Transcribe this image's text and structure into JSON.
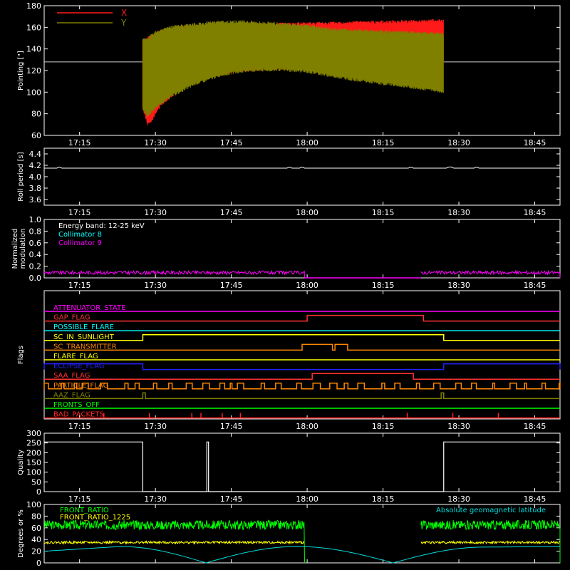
{
  "time_ticks": [
    "17:15",
    "17:30",
    "17:45",
    "18:00",
    "18:15",
    "18:30",
    "18:45"
  ],
  "colors": {
    "axis": "#ffffff",
    "x": "#ff1a1a",
    "y": "#7f7f00",
    "c8": "#00ffff",
    "c9": "#ff00ff",
    "front_ratio": "#00ff00",
    "front_ratio_1225": "#ffff00",
    "geomag": "#00dddd"
  },
  "chart_data": [
    {
      "id": "pointing",
      "type": "line",
      "ylabel": "Pointing [\"]",
      "ylim": [
        60,
        180
      ],
      "yticks": [
        60,
        80,
        100,
        120,
        140,
        160,
        180
      ],
      "legend": {
        "placement": "top-left",
        "entries": [
          {
            "label": "X",
            "color": "#ff1a1a"
          },
          {
            "label": "Y",
            "color": "#7f7f00"
          }
        ]
      },
      "reference_line": 128,
      "series": [
        {
          "name": "X",
          "t_start": "17:27:30",
          "t_end": "18:27:00",
          "upper": [
            [
              27.6,
              148
            ],
            [
              28.5,
              150
            ],
            [
              31,
              156
            ],
            [
              35,
              160
            ],
            [
              40,
              161
            ],
            [
              45,
              161
            ],
            [
              50,
              162
            ],
            [
              55,
              163
            ],
            [
              60,
              163.5
            ],
            [
              65,
              164
            ],
            [
              70,
              164.5
            ],
            [
              75,
              165
            ],
            [
              80,
              165.5
            ],
            [
              85,
              166
            ],
            [
              87,
              166
            ]
          ],
          "lower": [
            [
              27.6,
              84
            ],
            [
              28.5,
              70
            ],
            [
              29.5,
              76
            ],
            [
              31,
              88
            ],
            [
              35,
              104
            ],
            [
              40,
              114
            ],
            [
              45,
              119
            ],
            [
              50,
              121
            ],
            [
              55,
              122
            ],
            [
              60,
              123
            ],
            [
              65,
              124
            ],
            [
              70,
              126
            ],
            [
              75,
              127
            ],
            [
              80,
              128
            ],
            [
              85,
              129
            ],
            [
              87,
              128
            ]
          ]
        },
        {
          "name": "Y",
          "t_start": "17:27:30",
          "t_end": "18:27:00",
          "upper": [
            [
              27.6,
              148
            ],
            [
              28.5,
              150
            ],
            [
              30,
              155
            ],
            [
              33,
              160
            ],
            [
              38,
              163
            ],
            [
              43,
              165
            ],
            [
              48,
              165
            ],
            [
              55,
              163
            ],
            [
              60,
              161
            ],
            [
              65,
              158
            ],
            [
              70,
              157
            ],
            [
              75,
              156
            ],
            [
              80,
              155
            ],
            [
              85,
              154
            ],
            [
              87,
              154
            ]
          ],
          "lower": [
            [
              27.6,
              84
            ],
            [
              28.5,
              78
            ],
            [
              30,
              86
            ],
            [
              33,
              96
            ],
            [
              38,
              108
            ],
            [
              43,
              116
            ],
            [
              48,
              120
            ],
            [
              55,
              121
            ],
            [
              60,
              119
            ],
            [
              65,
              115
            ],
            [
              70,
              111
            ],
            [
              75,
              108
            ],
            [
              80,
              105
            ],
            [
              85,
              102
            ],
            [
              87,
              100
            ]
          ]
        }
      ]
    },
    {
      "id": "roll_period",
      "type": "line",
      "ylabel": "Roll period [s]",
      "ylim": [
        3.5,
        4.5
      ],
      "yticks": [
        "3.6",
        "3.8",
        "4.0",
        "4.2",
        "4.4"
      ],
      "series": [
        {
          "name": "Roll period",
          "value": 4.15
        }
      ]
    },
    {
      "id": "modulation",
      "type": "line",
      "ylabel": "Normalized modulation",
      "ylim": [
        0,
        1
      ],
      "yticks": [
        "0.0",
        "0.2",
        "0.4",
        "0.6",
        "0.8",
        "1.0"
      ],
      "annotations": [
        {
          "text": "Energy band: 12-25 keV",
          "color": "#ffffff"
        },
        {
          "text": "Collimator 8",
          "color": "#00ffff"
        },
        {
          "text": "Collimator 9",
          "color": "#ff00ff"
        }
      ],
      "series": [
        {
          "name": "Collimator 9",
          "active": [
            [
              "17:08",
              "17:59:30"
            ],
            [
              "18:22:30",
              "18:50"
            ]
          ],
          "active_level": 0.09,
          "inactive_level": 0.0
        }
      ]
    },
    {
      "id": "flags",
      "type": "line",
      "ylabel": "Flags",
      "flags": [
        {
          "label": "ATTENUATOR_STATE",
          "color": "#ff00ff",
          "intervals": []
        },
        {
          "label": "GAP_FLAG",
          "color": "#ff3333",
          "intervals": [
            [
              "18:00",
              "18:23"
            ]
          ]
        },
        {
          "label": "POSSIBLE_FLARE",
          "color": "#00ffff",
          "intervals": []
        },
        {
          "label": "SC_IN_SUNLIGHT",
          "color": "#ffff00",
          "intervals": [
            [
              "17:27:30",
              "18:27:00"
            ]
          ]
        },
        {
          "label": "SC_TRANSMITTER",
          "color": "#ff8800",
          "intervals": [
            [
              "17:59",
              "18:05"
            ],
            [
              "18:05:30",
              "18:08"
            ]
          ]
        },
        {
          "label": "FLARE_FLAG",
          "color": "#ffff00",
          "intervals": []
        },
        {
          "label": "ECLIPSE_FLAG",
          "color": "#2222ff",
          "intervals": [
            [
              "17:08",
              "17:27:30"
            ],
            [
              "18:27:00",
              "18:50"
            ]
          ]
        },
        {
          "label": "SAA_FLAG",
          "color": "#ff3333",
          "intervals": [
            [
              "18:01",
              "18:21"
            ]
          ]
        },
        {
          "label": "PARTICLE_FLAG",
          "color": "#ff8800",
          "intervals": "intermittent"
        },
        {
          "label": "AAZ_FLAG",
          "color": "#7f7f00",
          "intervals": [
            [
              "17:27:30",
              "17:28:00"
            ],
            [
              "18:26:30",
              "18:27:00"
            ]
          ]
        },
        {
          "label": "FRONTS_OFF",
          "color": "#00ff00",
          "intervals": []
        },
        {
          "label": "BAD_PACKETS",
          "color": "#ff2222",
          "intervals": "spikes"
        }
      ]
    },
    {
      "id": "quality",
      "type": "line",
      "ylabel": "Quality",
      "ylim": [
        0,
        300
      ],
      "yticks": [
        0,
        50,
        100,
        150,
        200,
        250,
        300
      ],
      "series": [
        {
          "name": "Quality",
          "segments": [
            [
              "17:08",
              "17:27:30",
              255
            ],
            [
              "17:27:30",
              "17:40:10",
              0
            ],
            [
              "17:40:10",
              "17:40:30",
              255
            ],
            [
              "17:40:30",
              "18:27:00",
              0
            ],
            [
              "18:27:00",
              "18:50",
              255
            ]
          ]
        }
      ]
    },
    {
      "id": "ratios",
      "type": "line",
      "ylabel": "Degrees or %",
      "ylim": [
        0,
        100
      ],
      "yticks": [
        0,
        20,
        40,
        60,
        80,
        100
      ],
      "legend": {
        "placement": "top",
        "entries": [
          {
            "label": "FRONT_RATIO",
            "color": "#00ff00"
          },
          {
            "label": "FRONT_RATIO_1225",
            "color": "#ffff00"
          },
          {
            "label": "Absolute geomagnetic latitude",
            "color": "#00dddd"
          }
        ]
      },
      "series": [
        {
          "name": "FRONT_RATIO",
          "level": 65,
          "active": [
            [
              "17:08",
              "17:59:30"
            ],
            [
              "18:22:30",
              "18:50"
            ]
          ]
        },
        {
          "name": "FRONT_RATIO_1225",
          "level": 35,
          "active": [
            [
              "17:08",
              "17:59:30"
            ],
            [
              "18:22:30",
              "18:50"
            ]
          ]
        },
        {
          "name": "Absolute geomagnetic latitude",
          "points": [
            [
              "17:08",
              20
            ],
            [
              "17:23",
              28
            ],
            [
              "17:40",
              0
            ],
            [
              "17:58",
              28
            ],
            [
              "18:17",
              0
            ],
            [
              "18:35",
              27
            ],
            [
              "18:50",
              28
            ]
          ]
        }
      ]
    }
  ]
}
